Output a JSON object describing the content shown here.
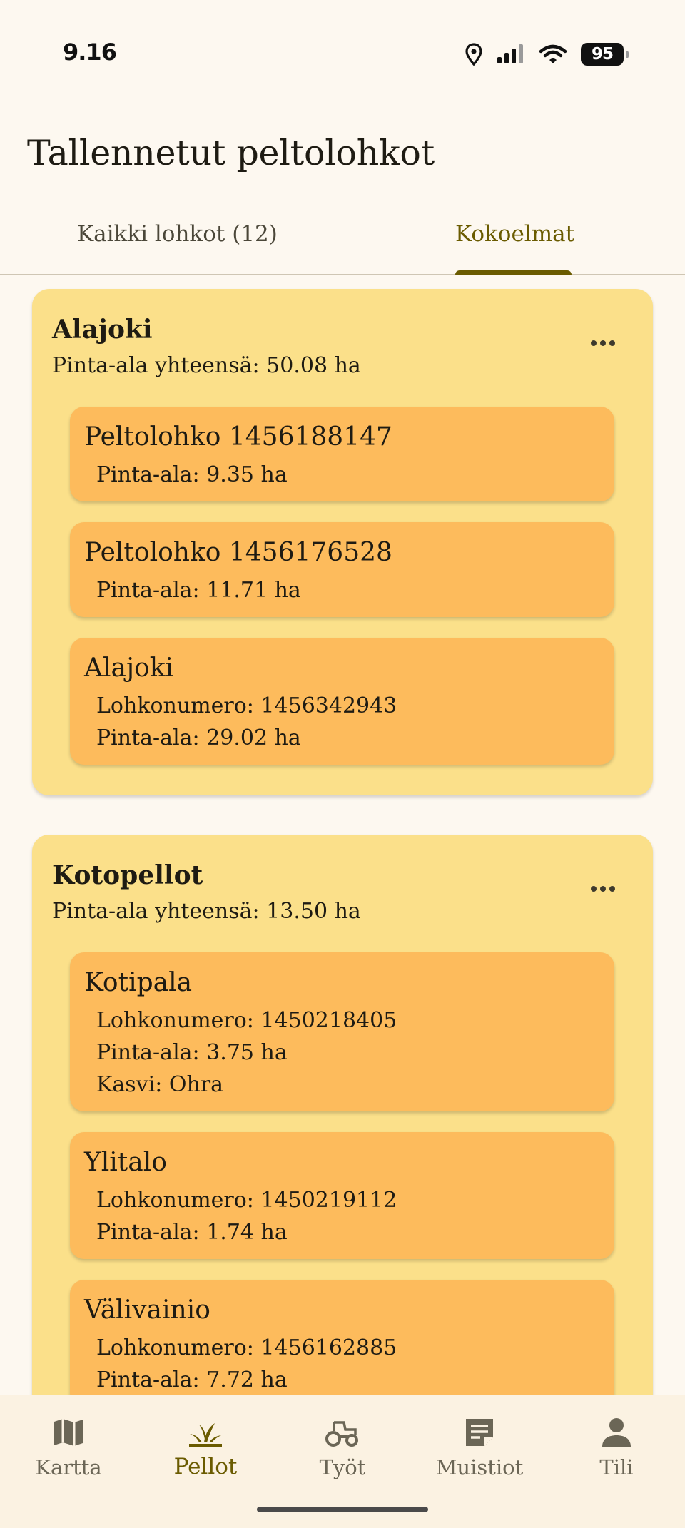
{
  "status_bar": {
    "time": "9.16",
    "battery": "95"
  },
  "header": {
    "title": "Tallennetut peltolohkot"
  },
  "tabs": [
    {
      "label": "Kaikki lohkot (12)",
      "active": false
    },
    {
      "label": "Kokoelmat",
      "active": true
    }
  ],
  "collections": [
    {
      "name": "Alajoki",
      "total": "Pinta-ala yhteensä: 50.08 ha",
      "fields": [
        {
          "name": "Peltolohko 1456188147",
          "lines": [
            "Pinta-ala: 9.35 ha"
          ]
        },
        {
          "name": "Peltolohko 1456176528",
          "lines": [
            "Pinta-ala: 11.71 ha"
          ]
        },
        {
          "name": "Alajoki",
          "lines": [
            "Lohkonumero: 1456342943",
            "Pinta-ala: 29.02 ha"
          ]
        }
      ]
    },
    {
      "name": "Kotopellot",
      "total": "Pinta-ala yhteensä: 13.50 ha",
      "fields": [
        {
          "name": "Kotipala",
          "lines": [
            "Lohkonumero: 1450218405",
            "Pinta-ala: 3.75 ha",
            "Kasvi: Ohra"
          ]
        },
        {
          "name": "Ylitalo",
          "lines": [
            "Lohkonumero: 1450219112",
            "Pinta-ala: 1.74 ha"
          ]
        },
        {
          "name": "Välivainio",
          "lines": [
            "Lohkonumero: 1456162885",
            "Pinta-ala: 7.72 ha"
          ]
        }
      ]
    }
  ],
  "bottom_nav": [
    {
      "label": "Kartta",
      "icon": "map-icon",
      "active": false
    },
    {
      "label": "Pellot",
      "icon": "sprout-icon",
      "active": true
    },
    {
      "label": "Työt",
      "icon": "tractor-icon",
      "active": false
    },
    {
      "label": "Muistiot",
      "icon": "note-icon",
      "active": false
    },
    {
      "label": "Tili",
      "icon": "person-icon",
      "active": false
    }
  ],
  "colors": {
    "background": "#fdf8f0",
    "collection_card": "#fbe08a",
    "field_card": "#fdbb5c",
    "accent": "#6a5b00"
  }
}
